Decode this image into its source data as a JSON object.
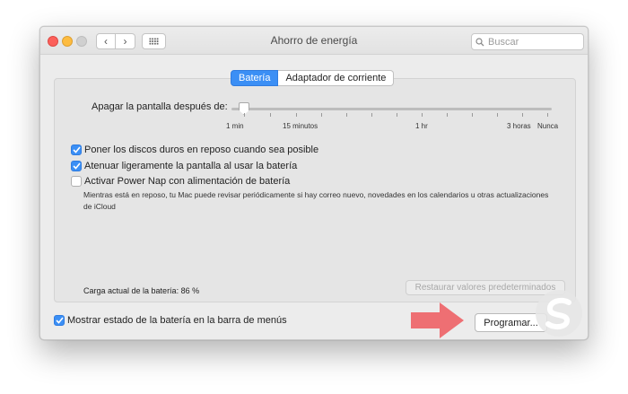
{
  "window": {
    "title": "Ahorro de energía",
    "search_placeholder": "Buscar",
    "nav_back": "‹",
    "nav_forward": "›"
  },
  "tabs": [
    {
      "label": "Batería",
      "active": true
    },
    {
      "label": "Adaptador de corriente",
      "active": false
    }
  ],
  "slider": {
    "label": "Apagar la pantalla después de:",
    "ticks": [
      "1 min",
      "15 minutos",
      "1 hr",
      "3 horas",
      "Nunca"
    ],
    "selected": "1 min"
  },
  "options": [
    {
      "label": "Poner los discos duros en reposo cuando sea posible",
      "checked": true
    },
    {
      "label": "Atenuar ligeramente la pantalla al usar la batería",
      "checked": true
    },
    {
      "label": "Activar Power Nap con alimentación de batería",
      "checked": false
    }
  ],
  "power_nap_description": "Mientras está en reposo, tu Mac puede revisar periódicamente si hay correo nuevo, novedades en los calendarios u otras actualizaciones de iCloud",
  "battery_status": "Carga actual de la batería: 86 %",
  "restore_button": "Restaurar valores predeterminados",
  "menu_bar_option": {
    "label": "Mostrar estado de la batería en la barra de menús",
    "checked": true
  },
  "schedule_button": "Programar...",
  "colors": {
    "accent": "#3b8ff5",
    "annotation_arrow": "#ee6f73"
  }
}
